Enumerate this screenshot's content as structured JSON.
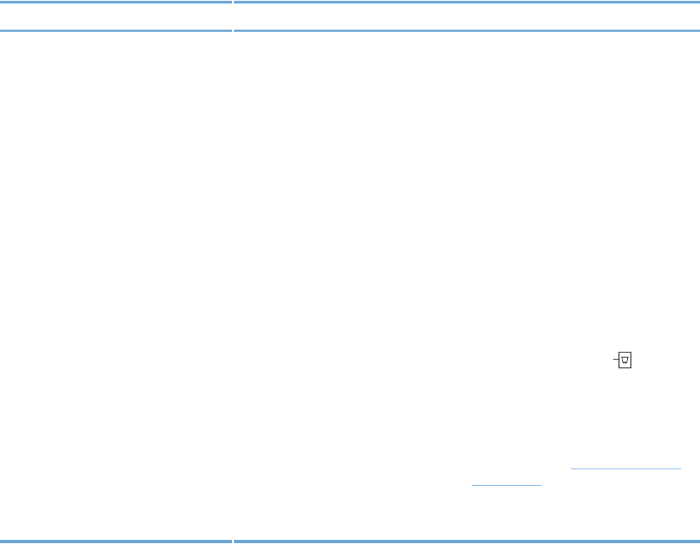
{
  "page": {
    "accent_color": "#6ea9d8",
    "link_color": "#4a90d9"
  },
  "icons": {
    "port": "network-port-icon"
  },
  "links": [
    {
      "text": ""
    },
    {
      "text": ""
    }
  ]
}
